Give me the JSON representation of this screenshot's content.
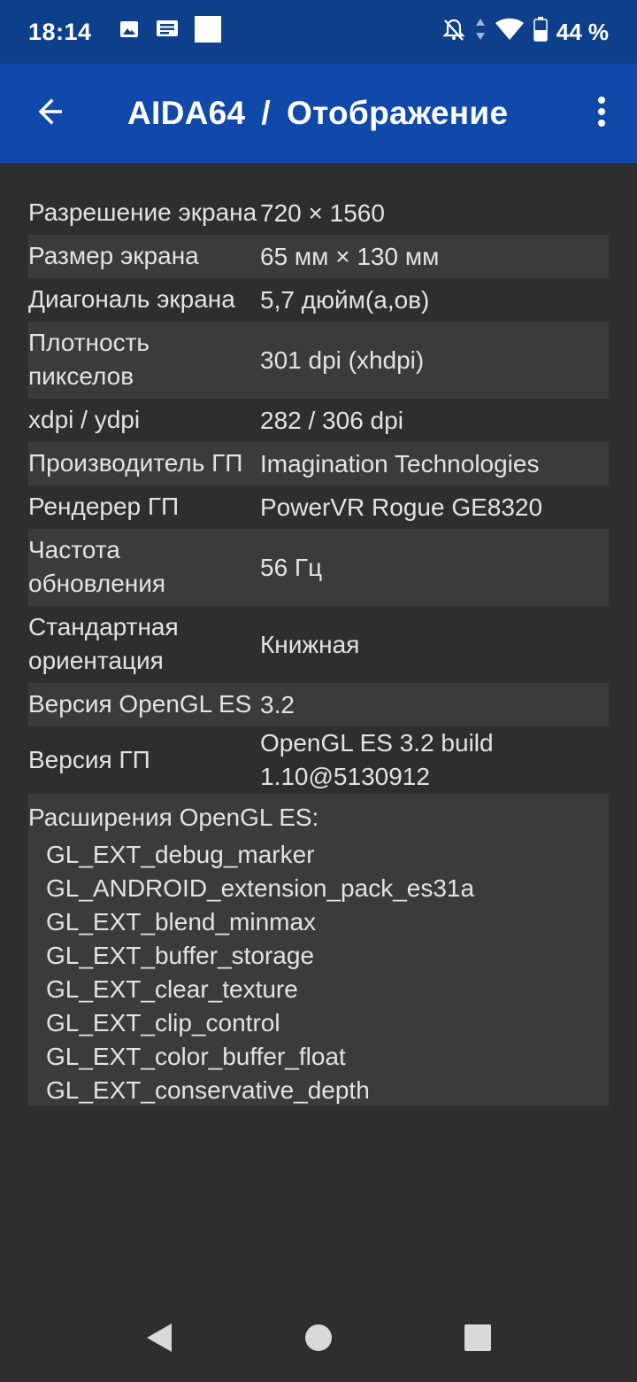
{
  "statusbar": {
    "time": "18:14",
    "battery": "44 %",
    "icons": [
      "image-notification-icon",
      "message-notification-icon",
      "square-notification-icon",
      "muted-bell-icon",
      "data-arrows-icon",
      "wifi-icon",
      "battery-icon"
    ]
  },
  "appbar": {
    "app_name": "AIDA64",
    "separator": "/",
    "page_title": "Отображение",
    "back_icon": "arrow-left-icon",
    "menu_icon": "more-vertical-icon"
  },
  "rows": [
    {
      "label": "Разрешение экрана",
      "value": "720 × 1560"
    },
    {
      "label": "Размер экрана",
      "value": "65 мм × 130 мм"
    },
    {
      "label": "Диагональ экрана",
      "value": "5,7 дюйм(а,ов)"
    },
    {
      "label": "Плотность пикселов",
      "value": "301 dpi (xhdpi)"
    },
    {
      "label": "xdpi / ydpi",
      "value": "282 / 306 dpi"
    },
    {
      "label": "Производитель ГП",
      "value": "Imagination Technologies"
    },
    {
      "label": "Рендерер ГП",
      "value": "PowerVR Rogue GE8320"
    },
    {
      "label": "Частота обновления",
      "value": "56 Гц"
    },
    {
      "label": "Стандартная ориентация",
      "value": "Книжная"
    },
    {
      "label": "Версия OpenGL ES",
      "value": "3.2"
    },
    {
      "label": "Версия ГП",
      "value": "OpenGL ES 3.2 build 1.10@5130912"
    }
  ],
  "extensions": {
    "title": "Расширения OpenGL ES:",
    "items": [
      "GL_EXT_debug_marker",
      "GL_ANDROID_extension_pack_es31a",
      "GL_EXT_blend_minmax",
      "GL_EXT_buffer_storage",
      "GL_EXT_clear_texture",
      "GL_EXT_clip_control",
      "GL_EXT_color_buffer_float",
      "GL_EXT_conservative_depth"
    ]
  },
  "navbar": {
    "back_icon": "nav-back-icon",
    "home_icon": "nav-home-icon",
    "recents_icon": "nav-recents-icon"
  }
}
